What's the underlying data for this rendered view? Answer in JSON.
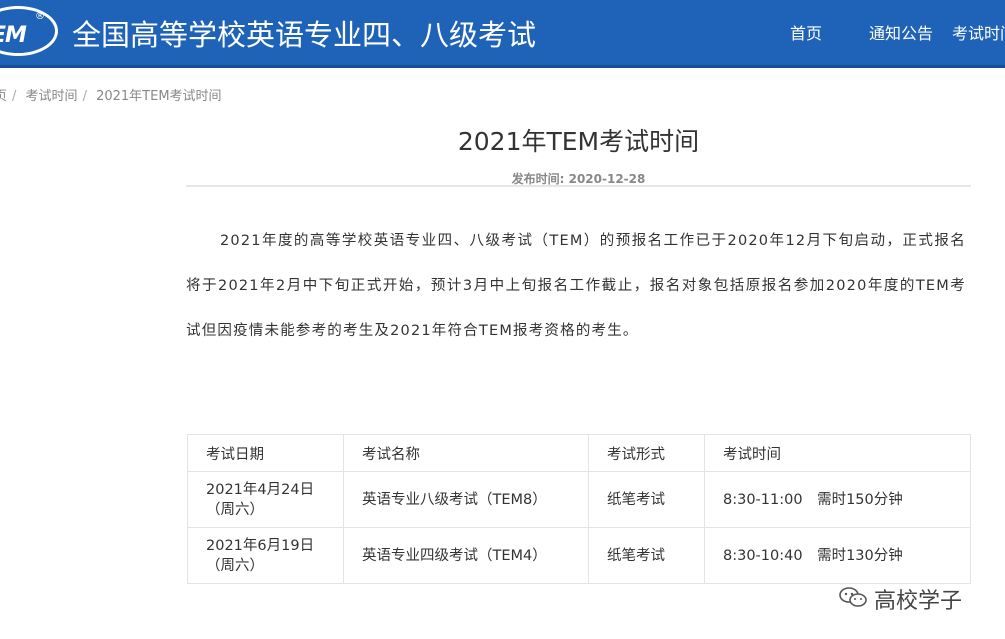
{
  "header": {
    "logo_text": "TEM",
    "logo_reg": "®",
    "site_title": "全国高等学校英语专业四、八级考试",
    "nav": [
      "首页",
      "通知公告",
      "考试时间"
    ]
  },
  "breadcrumb": [
    "页",
    "考试时间",
    "2021年TEM考试时间"
  ],
  "article": {
    "title": "2021年TEM考试时间",
    "pubdate": "发布时间: 2020-12-28",
    "body": "2021年度的高等学校英语专业四、八级考试（TEM）的预报名工作已于2020年12月下旬启动，正式报名将于2021年2月中下旬正式开始，预计3月中上旬报名工作截止，报名对象包括原报名参加2020年度的TEM考试但因疫情未能参考的考生及2021年符合TEM报考资格的考生。"
  },
  "table": {
    "headers": [
      "考试日期",
      "考试名称",
      "考试形式",
      "考试时间"
    ],
    "rows": [
      {
        "date": "2021年4月24日",
        "weekday": "（周六）",
        "name": "英语专业八级考试（TEM8）",
        "form": "纸笔考试",
        "time": "8:30-11:00　需时150分钟"
      },
      {
        "date": "2021年6月19日",
        "weekday": "（周六）",
        "name": "英语专业四级考试（TEM4）",
        "form": "纸笔考试",
        "time": "8:30-10:40　需时130分钟"
      }
    ]
  },
  "watermark": {
    "icon": "wechat-icon",
    "text": "高校学子"
  },
  "colors": {
    "header_bg": "#1f63b8"
  }
}
